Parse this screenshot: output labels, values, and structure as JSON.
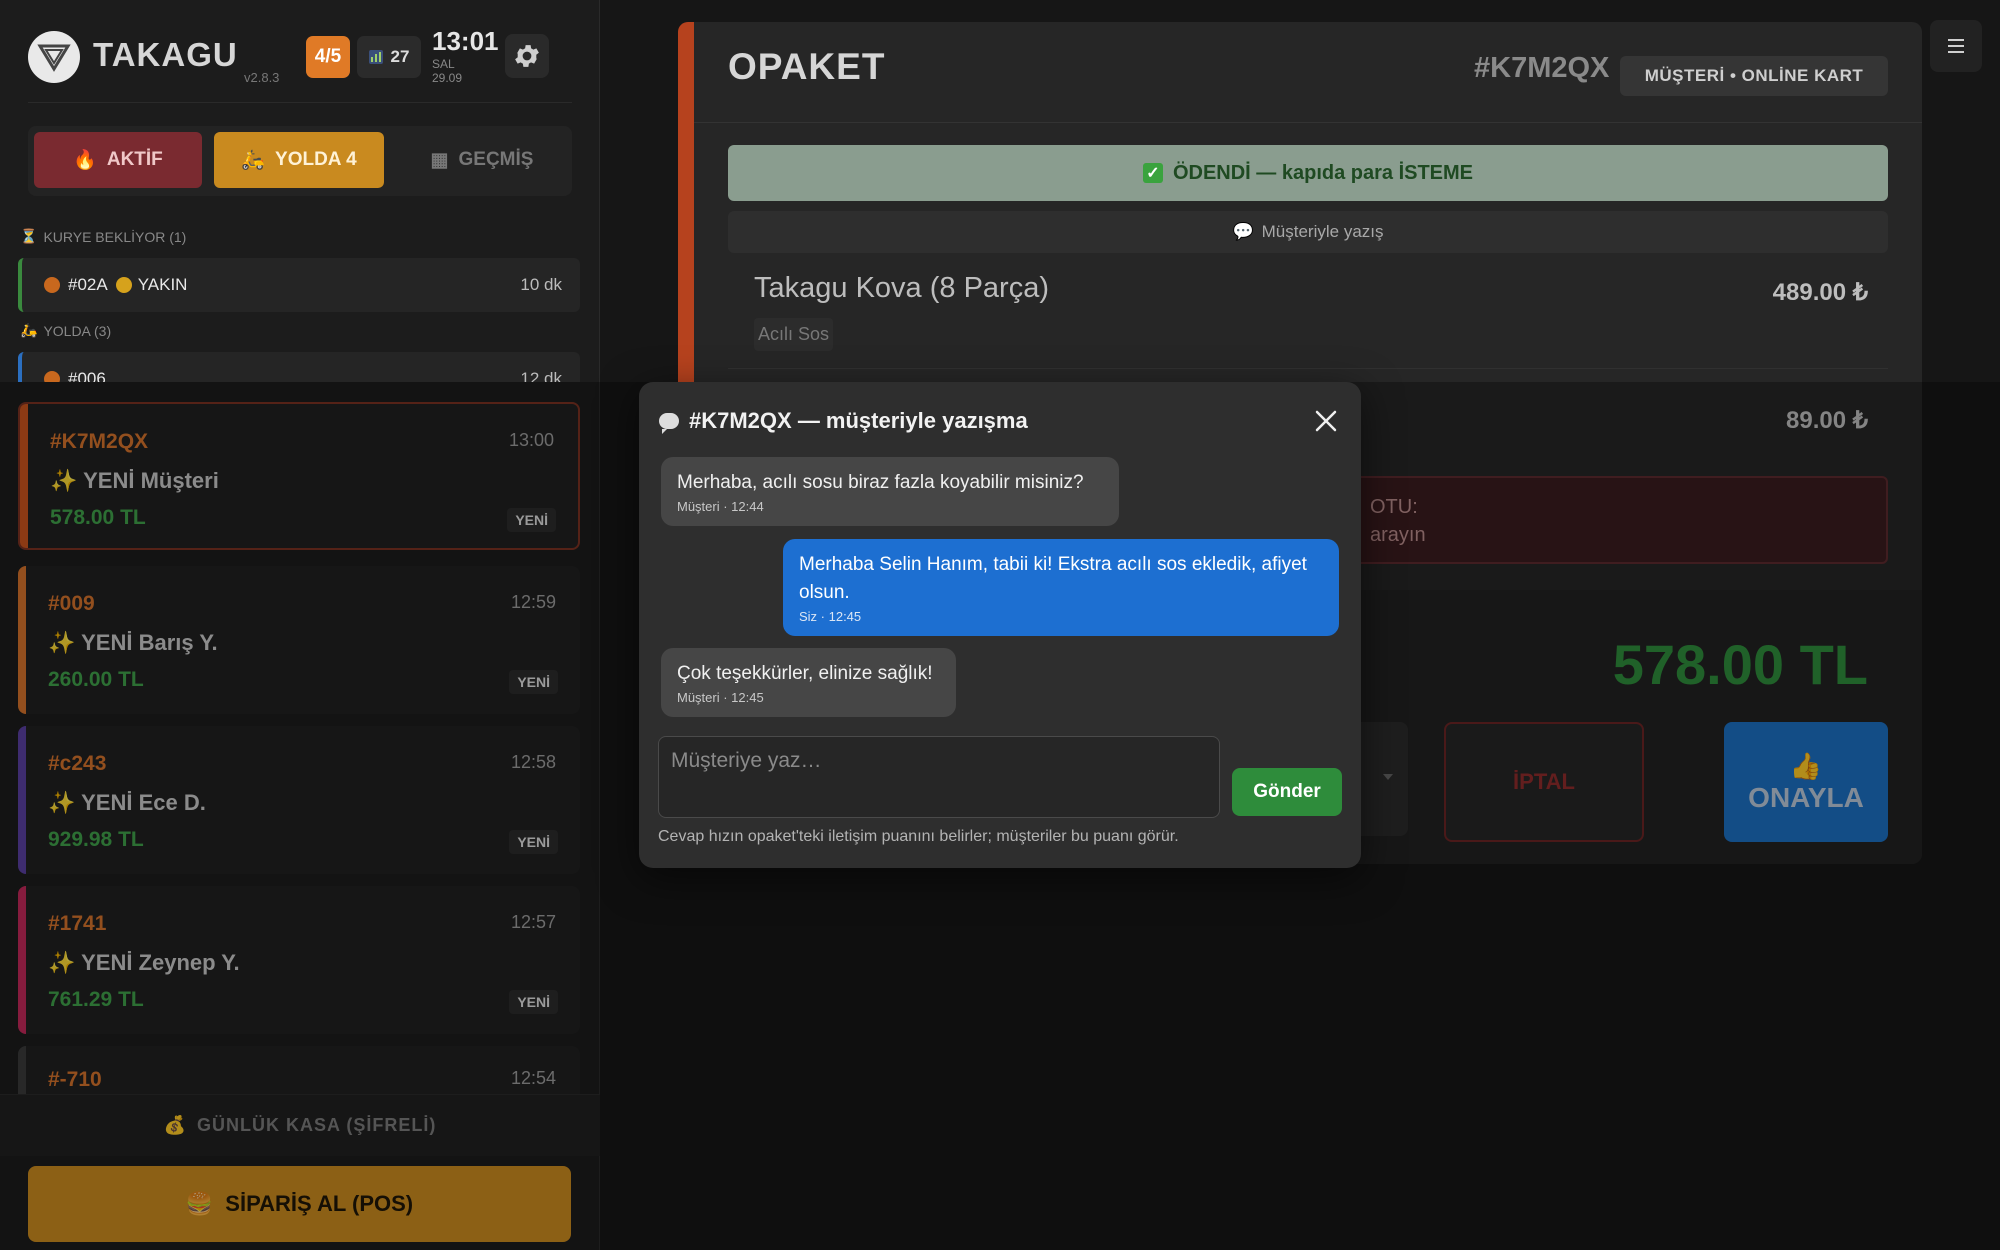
{
  "app": {
    "name": "TAKAGU",
    "version": "v2.8.3",
    "counter": "4/5",
    "stats_count": "27",
    "time": "13:01",
    "day": "SAL",
    "date": "29.09"
  },
  "tabs": [
    {
      "icon": "🔥",
      "label": "AKTİF"
    },
    {
      "icon": "🛵",
      "label": "YOLDA 4"
    },
    {
      "icon": "▦",
      "label": "GEÇMİŞ"
    }
  ],
  "sections": {
    "courier_waiting": {
      "icon": "⏳",
      "label": "KURYE BEKLİYOR (1)"
    },
    "on_the_way": {
      "icon": "🛵",
      "label": "YOLDA (3)"
    }
  },
  "mini_orders": [
    {
      "id": "#02A",
      "tag": "YAKIN",
      "time": "10 dk"
    },
    {
      "id": "#006",
      "time": "12 dk"
    }
  ],
  "orders": [
    {
      "id": "#K7M2QX",
      "time": "13:00",
      "name": "YENİ Müşteri",
      "amount": "578.00 TL",
      "badge": "YENİ",
      "accent": "#c9541e"
    },
    {
      "id": "#009",
      "time": "12:59",
      "name": "YENİ Barış Y.",
      "amount": "260.00 TL",
      "badge": "YENİ",
      "accent": "#d3722c"
    },
    {
      "id": "#c243",
      "time": "12:58",
      "name": "YENİ Ece D.",
      "amount": "929.98 TL",
      "badge": "YENİ",
      "accent": "#5a3fa0"
    },
    {
      "id": "#1741",
      "time": "12:57",
      "name": "YENİ Zeynep Y.",
      "amount": "761.29 TL",
      "badge": "YENİ",
      "accent": "#c0295a"
    },
    {
      "id": "#-710",
      "time": "12:54"
    }
  ],
  "bottom": {
    "kasa_label": "GÜNLÜK KASA (ŞİFRELİ)",
    "pos_label": "SİPARİŞ AL (POS)"
  },
  "detail": {
    "title": "OPAKET",
    "order_id": "#K7M2QX",
    "payment": "MÜŞTERİ • ONLİNE KART",
    "paid_text": "ÖDENDİ — kapıda para İSTEME",
    "chat_link": "Müşteriyle yazış",
    "item_name": "Takagu Kova (8 Parça)",
    "item_price": "489.00 ₺",
    "item_option": "Acılı Sos",
    "item2_price": "89.00 ₺",
    "note_line1": "OTU:",
    "note_line2": "arayın",
    "total": "578.00 TL",
    "cancel_label": "İPTAL",
    "approve_label": "ONAYLA"
  },
  "chat": {
    "title": "#K7M2QX — müşteriyle yazışma",
    "messages": [
      {
        "text": "Merhaba, acılı sosu biraz fazla koyabilir misiniz?",
        "meta": "Müşteri · 12:44"
      },
      {
        "text": "Merhaba Selin Hanım, tabii ki! Ekstra acılı sos ekledik, afiyet olsun.",
        "meta": "Siz · 12:45"
      },
      {
        "text": "Çok teşekkürler, elinize sağlık!",
        "meta": "Müşteri · 12:45"
      }
    ],
    "placeholder": "Müşteriye yaz…",
    "send_label": "Gönder",
    "footer": "Cevap hızın opaket'teki iletişim puanını belirler; müşteriler bu puanı görür."
  },
  "colors": {
    "accent_orange": "#c98a1f",
    "order_id": "#d3722c",
    "amount_green": "#3fa04a",
    "send_green": "#2e8c3b",
    "out_bubble": "#1d6fd1"
  }
}
